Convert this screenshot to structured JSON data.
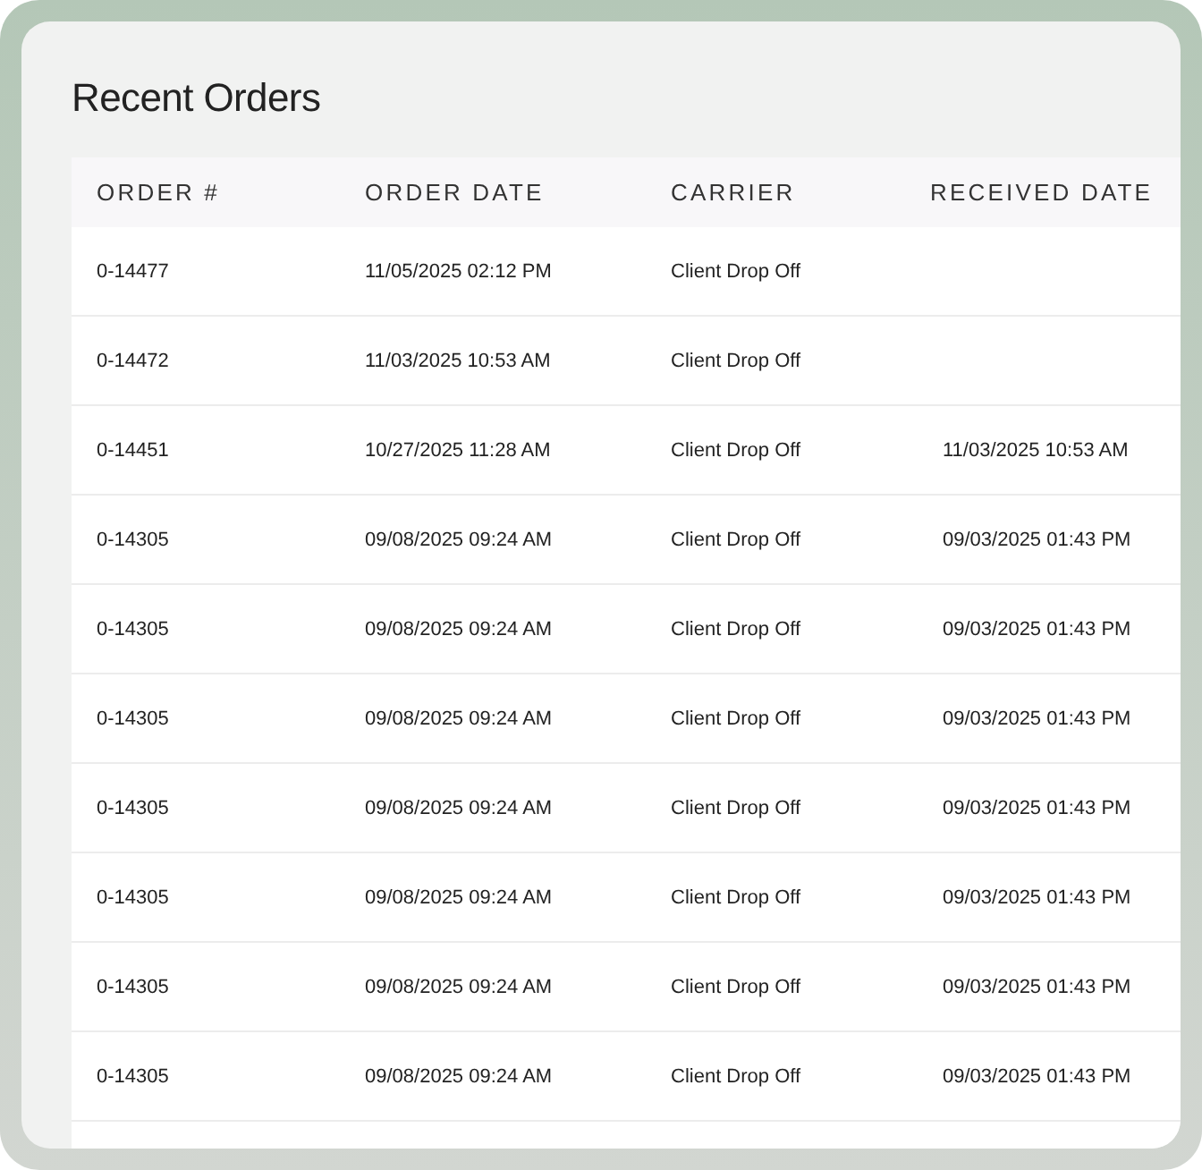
{
  "title": "Recent Orders",
  "table": {
    "columns": [
      "ORDER #",
      "ORDER DATE",
      "CARRIER",
      "RECEIVED DATE"
    ],
    "rows": [
      [
        "0-14477",
        "11/05/2025 02:12 PM",
        "Client Drop Off",
        ""
      ],
      [
        "0-14472",
        "11/03/2025 10:53 AM",
        "Client Drop Off",
        ""
      ],
      [
        "0-14451",
        "10/27/2025 11:28 AM",
        "Client Drop Off",
        "11/03/2025 10:53 AM"
      ],
      [
        "0-14305",
        "09/08/2025 09:24 AM",
        "Client Drop Off",
        "09/03/2025 01:43 PM"
      ],
      [
        "0-14305",
        "09/08/2025 09:24 AM",
        "Client Drop Off",
        "09/03/2025 01:43 PM"
      ],
      [
        "0-14305",
        "09/08/2025 09:24 AM",
        "Client Drop Off",
        "09/03/2025 01:43 PM"
      ],
      [
        "0-14305",
        "09/08/2025 09:24 AM",
        "Client Drop Off",
        "09/03/2025 01:43 PM"
      ],
      [
        "0-14305",
        "09/08/2025 09:24 AM",
        "Client Drop Off",
        "09/03/2025 01:43 PM"
      ],
      [
        "0-14305",
        "09/08/2025 09:24 AM",
        "Client Drop Off",
        "09/03/2025 01:43 PM"
      ],
      [
        "0-14305",
        "09/08/2025 09:24 AM",
        "Client Drop Off",
        "09/03/2025 01:43 PM"
      ]
    ]
  }
}
